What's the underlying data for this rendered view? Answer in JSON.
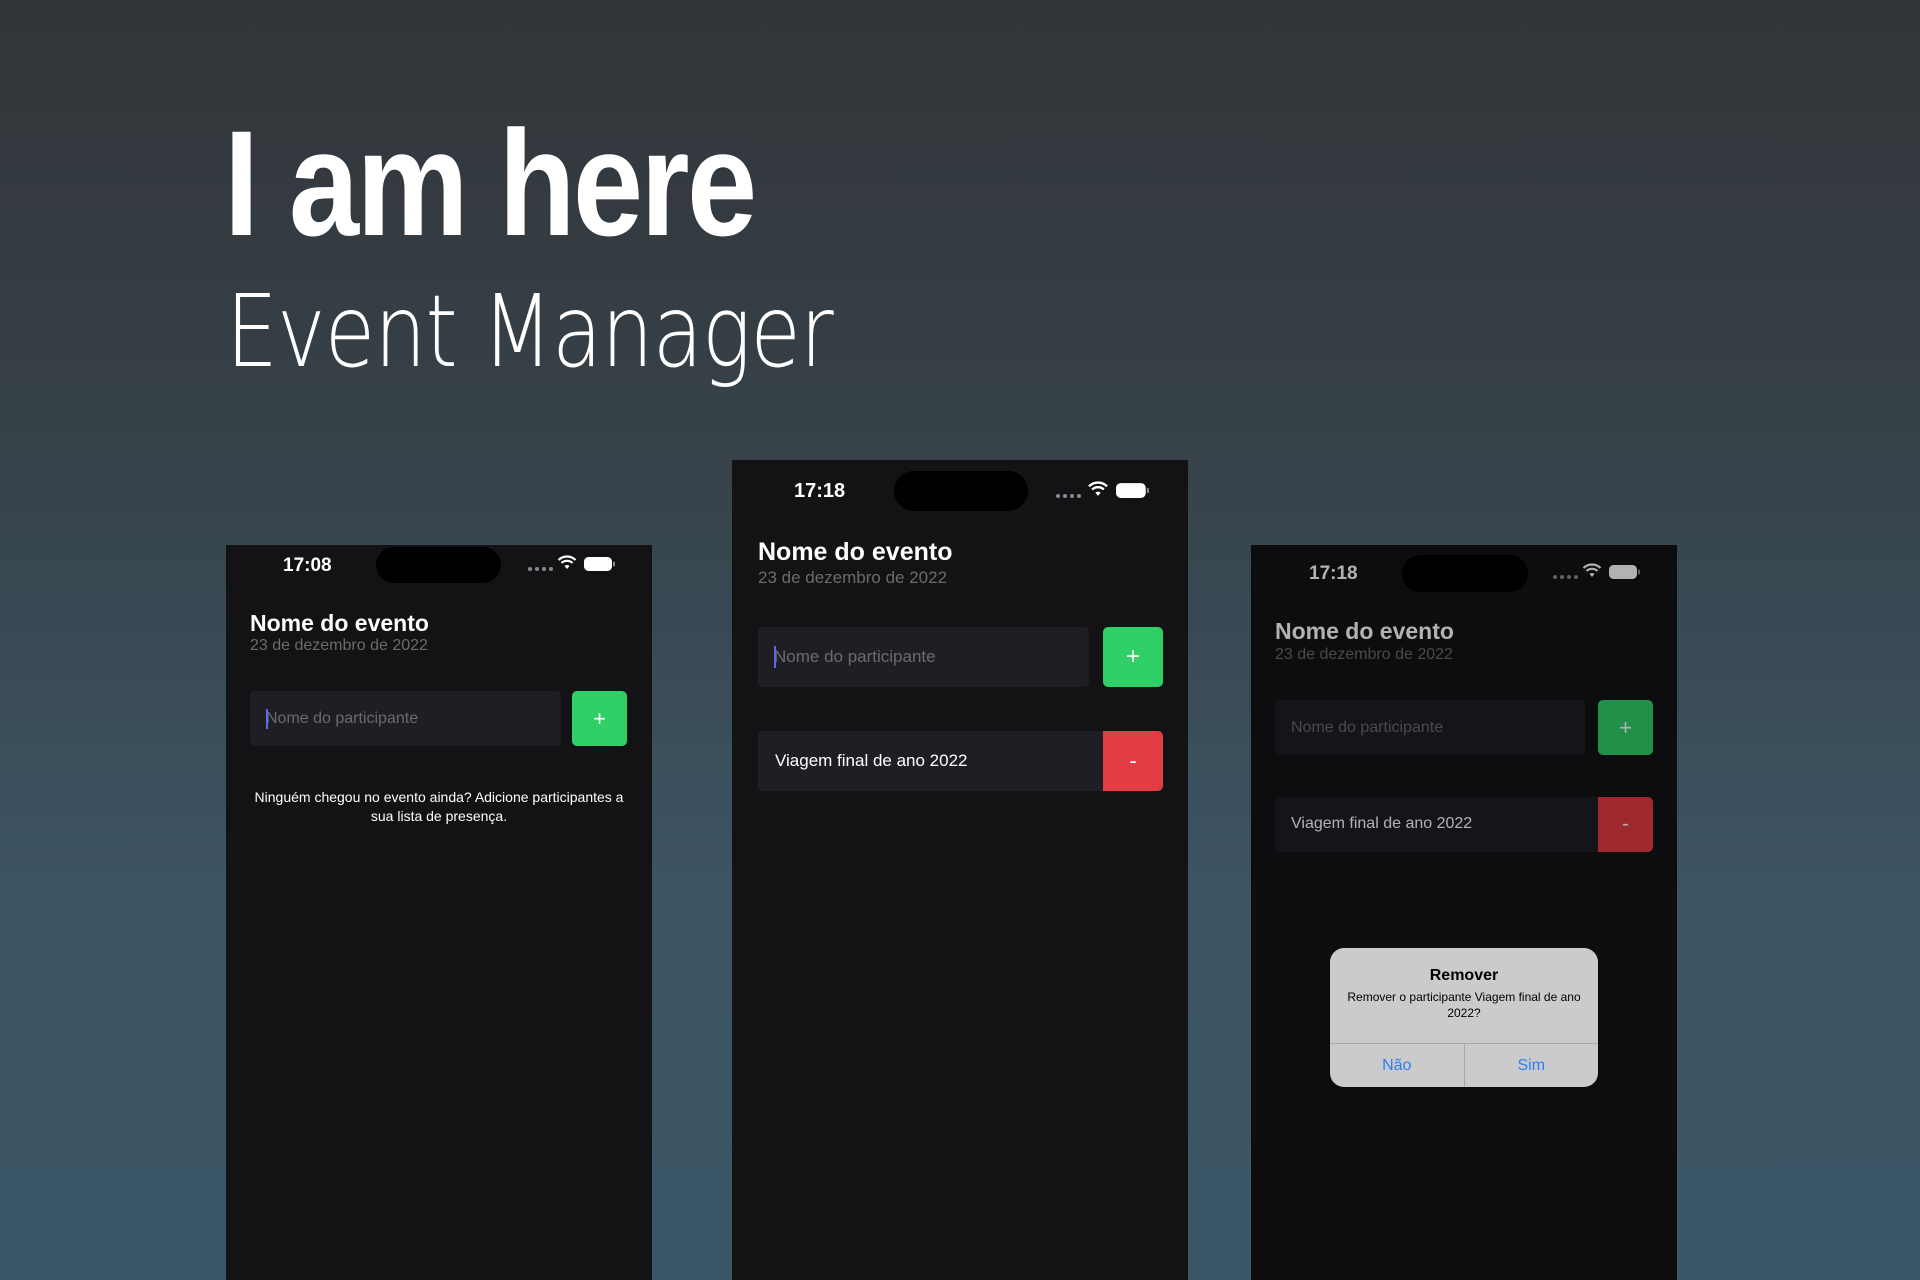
{
  "hero": {
    "title": "I am here",
    "subtitle": "Event Manager"
  },
  "colors": {
    "background": "#313438",
    "phone_background": "#131316",
    "input_background": "#1f1e25",
    "add_green": "#31cf67",
    "remove_red": "#e23c44",
    "alert_blue": "#2f7ef0"
  },
  "screens": [
    {
      "status_time": "17:08",
      "event_title": "Nome do evento",
      "event_date": "23 de dezembro de 2022",
      "input_placeholder": "Nome do participante",
      "add_label": "+",
      "empty_message": "Ninguém chegou no evento ainda? Adicione participantes a sua lista de presença."
    },
    {
      "status_time": "17:18",
      "event_title": "Nome do evento",
      "event_date": "23 de dezembro de 2022",
      "input_placeholder": "Nome do participante",
      "add_label": "+",
      "participants": [
        {
          "name": "Viagem final de ano 2022",
          "remove_label": "-"
        }
      ]
    },
    {
      "status_time": "17:18",
      "event_title": "Nome do evento",
      "event_date": "23 de dezembro de 2022",
      "input_placeholder": "Nome do participante",
      "add_label": "+",
      "participants": [
        {
          "name": "Viagem final de ano 2022",
          "remove_label": "-"
        }
      ],
      "alert": {
        "title": "Remover",
        "message": "Remover o participante Viagem final de ano 2022?",
        "cancel_label": "Não",
        "confirm_label": "Sim"
      }
    }
  ],
  "icons": [
    "signal-dots-icon",
    "wifi-icon",
    "battery-icon",
    "text-caret"
  ]
}
